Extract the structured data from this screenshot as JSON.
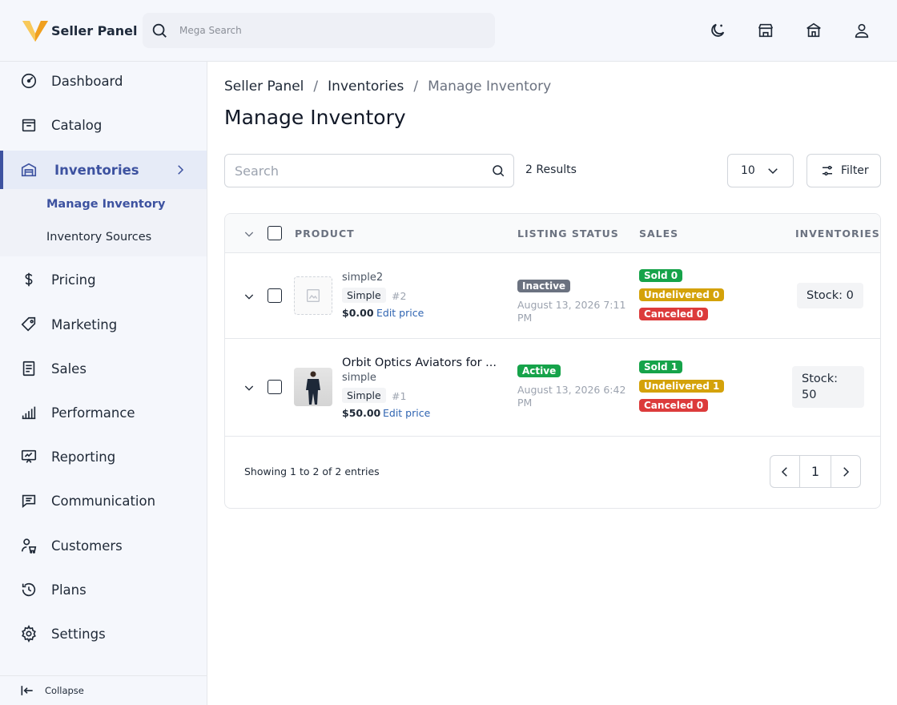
{
  "header": {
    "brand": "Seller Panel",
    "search_placeholder": "Mega Search",
    "icons": [
      "moon-icon",
      "store-icon",
      "shop-icon",
      "user-icon"
    ]
  },
  "sidebar": {
    "items": [
      {
        "label": "Dashboard",
        "icon": "dashboard-icon"
      },
      {
        "label": "Catalog",
        "icon": "catalog-icon"
      },
      {
        "label": "Inventories",
        "icon": "warehouse-icon"
      },
      {
        "label": "Pricing",
        "icon": "dollar-icon"
      },
      {
        "label": "Marketing",
        "icon": "tag-icon"
      },
      {
        "label": "Sales",
        "icon": "receipt-icon"
      },
      {
        "label": "Performance",
        "icon": "bar-chart-icon"
      },
      {
        "label": "Reporting",
        "icon": "presentation-icon"
      },
      {
        "label": "Communication",
        "icon": "chat-icon"
      },
      {
        "label": "Customers",
        "icon": "customers-icon"
      },
      {
        "label": "Plans",
        "icon": "history-icon"
      },
      {
        "label": "Settings",
        "icon": "gear-icon"
      }
    ],
    "sub_items": [
      {
        "label": "Manage Inventory"
      },
      {
        "label": "Inventory Sources"
      }
    ],
    "collapse_label": "Collapse"
  },
  "breadcrumb": {
    "root": "Seller Panel",
    "parent": "Inventories",
    "current": "Manage Inventory",
    "separator": "/"
  },
  "page": {
    "title": "Manage Inventory",
    "search_placeholder": "Search",
    "results": "2 Results",
    "per_page": "10",
    "filter_label": "Filter"
  },
  "table": {
    "headers": {
      "product": "PRODUCT",
      "listing_status": "LISTING STATUS",
      "sales": "SALES",
      "inventories": "INVENTORIES"
    },
    "rows": [
      {
        "name": "simple2",
        "type": "Simple",
        "id": "#2",
        "price": "$0.00",
        "edit_label": "Edit price",
        "status": "Inactive",
        "date": "August 13, 2026 7:11 PM",
        "sold": "Sold 0",
        "undelivered": "Undelivered 0",
        "canceled": "Canceled 0",
        "stock": "Stock: 0"
      },
      {
        "name": "Orbit Optics Aviators for ...",
        "sub_type": "simple",
        "type": "Simple",
        "id": "#1",
        "price": "$50.00",
        "edit_label": "Edit price",
        "status": "Active",
        "date": "August 13, 2026 6:42 PM",
        "sold": "Sold 1",
        "undelivered": "Undelivered 1",
        "canceled": "Canceled 0",
        "stock": "Stock: 50"
      }
    ],
    "footer": "Showing 1 to 2 of 2 entries",
    "page_number": "1"
  },
  "colors": {
    "accent": "#3d52a0",
    "inactive": "#6b7280",
    "active": "#16a34a",
    "sold": "#16a34a",
    "undelivered": "#d4a20a",
    "canceled": "#dc3b3b",
    "link": "#2f64b1"
  }
}
